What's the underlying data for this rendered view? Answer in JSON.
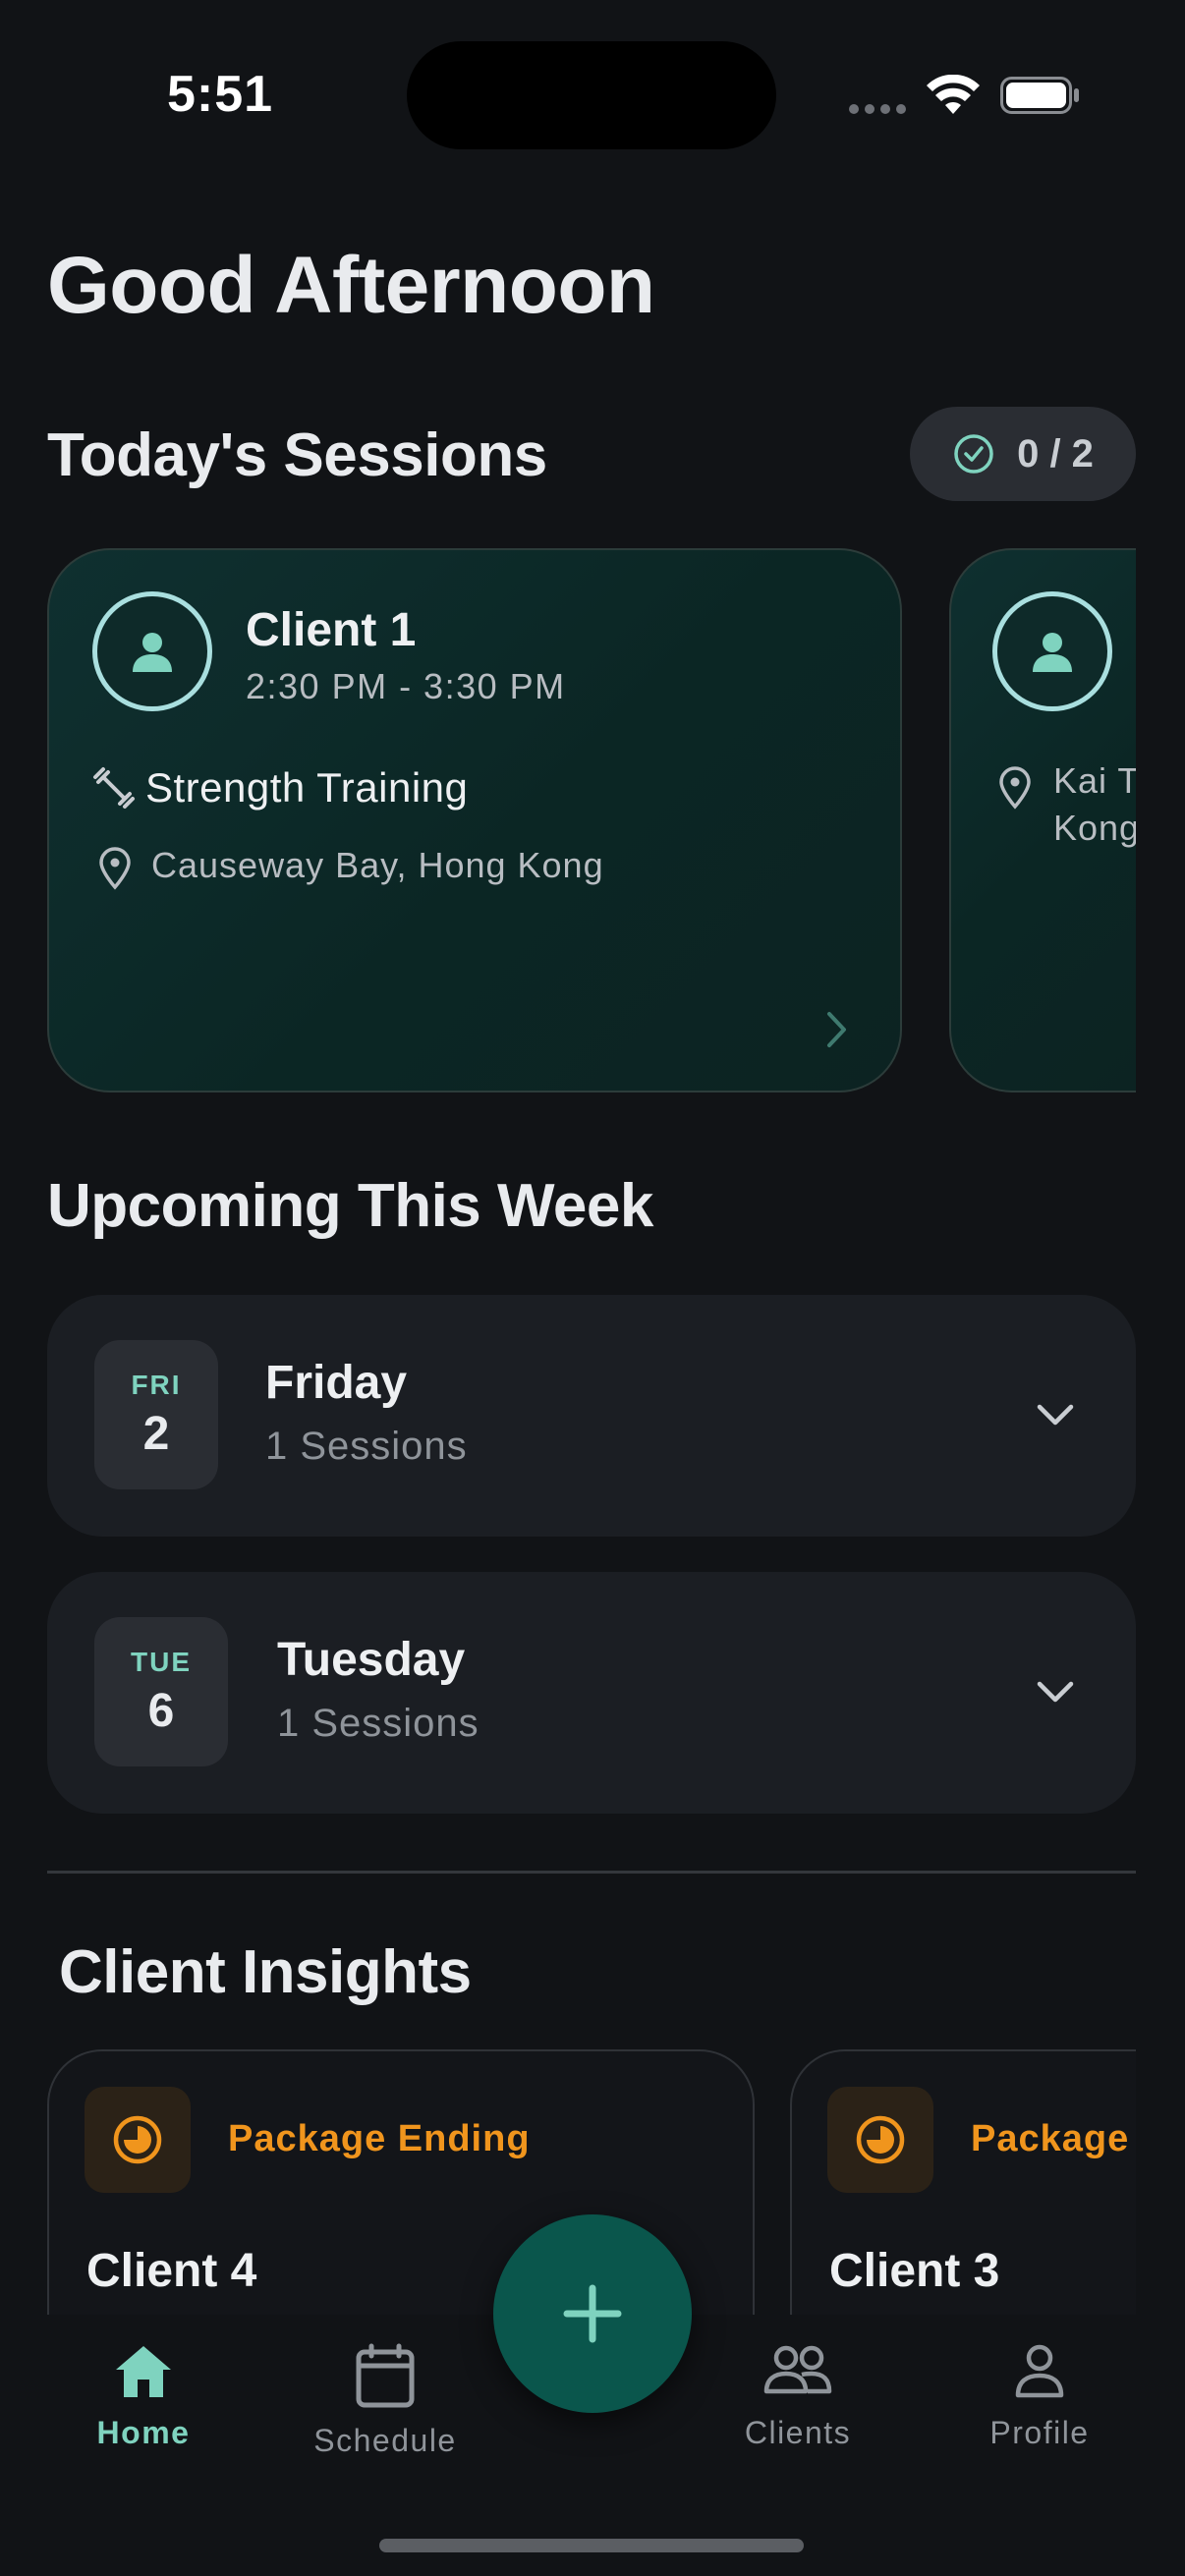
{
  "status_bar": {
    "time": "5:51"
  },
  "greeting": "Good Afternoon",
  "todays_sessions": {
    "title": "Today's Sessions",
    "progress": "0 / 2",
    "cards": [
      {
        "client": "Client 1",
        "time": "2:30 PM - 3:30 PM",
        "type": "Strength Training",
        "location": "Causeway Bay, Hong Kong"
      },
      {
        "location_line1": "Kai T",
        "location_line2": "Kong"
      }
    ]
  },
  "upcoming": {
    "title": "Upcoming This Week",
    "days": [
      {
        "dow": "FRI",
        "date": "2",
        "name": "Friday",
        "count": "1 Sessions"
      },
      {
        "dow": "TUE",
        "date": "6",
        "name": "Tuesday",
        "count": "1 Sessions"
      }
    ]
  },
  "insights": {
    "title": "Client Insights",
    "cards": [
      {
        "label": "Package Ending",
        "client": "Client 4"
      },
      {
        "label": "Package",
        "client": "Client 3"
      }
    ]
  },
  "tabbar": {
    "items": [
      {
        "label": "Home",
        "icon": "home-icon",
        "active": true
      },
      {
        "label": "Schedule",
        "icon": "calendar-icon"
      },
      {
        "label": "Clients",
        "icon": "users-icon"
      },
      {
        "label": "Profile",
        "icon": "person-icon"
      }
    ],
    "fab_icon": "plus-icon"
  },
  "colors": {
    "accent": "#7fd3bf",
    "warning": "#f0951d",
    "fab": "#0a564c",
    "background": "#111316"
  }
}
